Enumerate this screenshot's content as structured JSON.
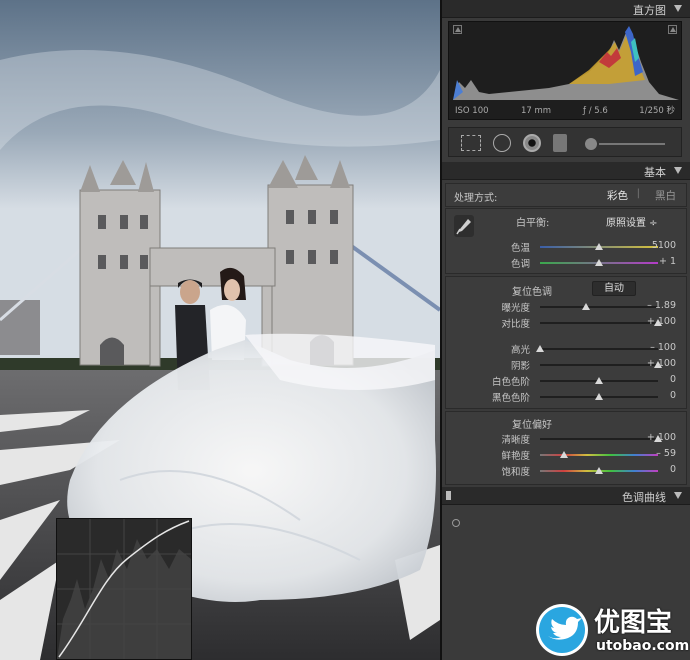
{
  "histogram": {
    "title": "直方图",
    "iso": "ISO 100",
    "focal": "17 mm",
    "aperture": "ƒ / 5.6",
    "shutter": "1/250 秒"
  },
  "basic": {
    "title": "基本",
    "treatment_label": "处理方式:",
    "color_option": "彩色",
    "bw_option": "黑白",
    "wb_label": "白平衡:",
    "wb_value": "原照设置 ÷",
    "temp_label": "色温",
    "temp_value": "5100",
    "tint_label": "色调",
    "tint_value": "+ 1",
    "tone_label": "复位色调",
    "auto_label": "自动",
    "exposure_label": "曝光度",
    "exposure_value": "– 1.89",
    "contrast_label": "对比度",
    "contrast_value": "+ 100",
    "highlights_label": "高光",
    "highlights_value": "– 100",
    "shadows_label": "阴影",
    "shadows_value": "+ 100",
    "whites_label": "白色色阶",
    "whites_value": "0",
    "blacks_label": "黑色色阶",
    "blacks_value": "0",
    "presence_label": "复位偏好",
    "clarity_label": "清晰度",
    "clarity_value": "+ 100",
    "vibrance_label": "鲜艳度",
    "vibrance_value": "– 59",
    "saturation_label": "饱和度",
    "saturation_value": "0"
  },
  "curve": {
    "title": "色调曲线"
  },
  "sliders": {
    "temp": 0.5,
    "tint": 0.5,
    "exposure": 0.39,
    "contrast": 1.0,
    "highlights": 0.0,
    "shadows": 1.0,
    "whites": 0.5,
    "blacks": 0.5,
    "clarity": 1.0,
    "vibrance": 0.2,
    "saturation": 0.5
  },
  "watermark": {
    "brand": "优图宝",
    "url": "utobao.com"
  }
}
